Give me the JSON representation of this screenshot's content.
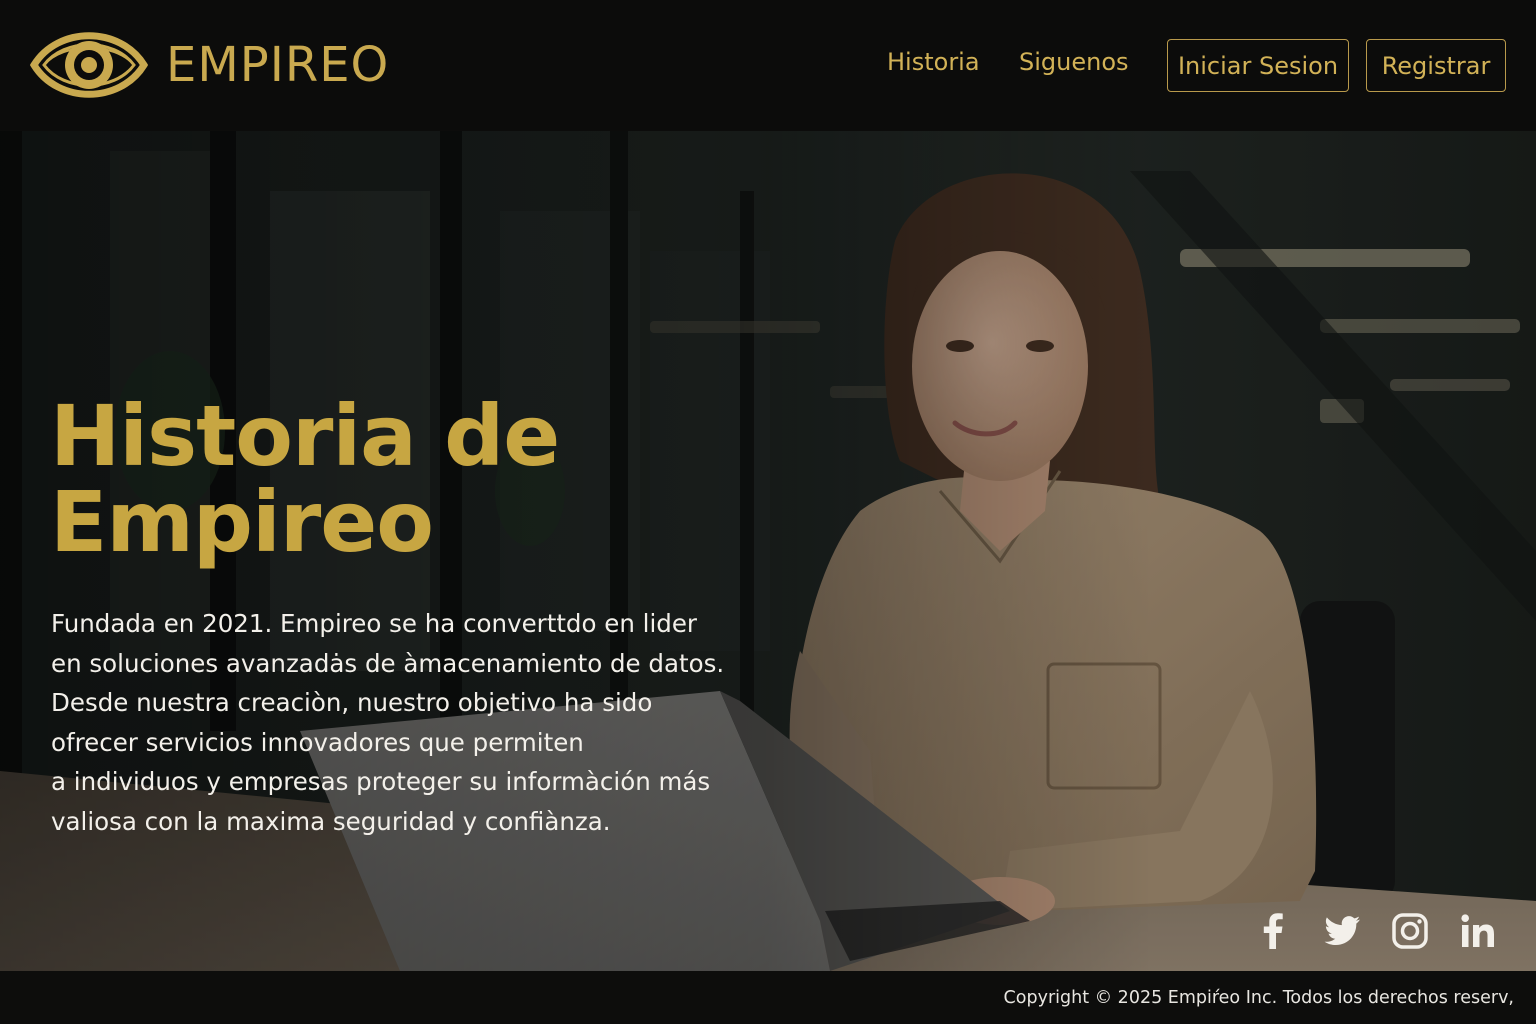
{
  "brand": {
    "name": "EMPIREO",
    "logo_icon": "eye-icon"
  },
  "nav": {
    "links": [
      "Historia",
      "Siguenos"
    ],
    "login_label": "Iniciar Sesion",
    "register_label": "Registrar"
  },
  "hero": {
    "title": "Historia de Empireo",
    "paragraph": "Fundada en 2021. Empireo se ha converttdo en lider en soluciones avanzadȧs de àmacenamiento de datos. Desde nuestra creaciòn, nuestro objetivo ha sido ofrecer servicios innovadores que permiten a individuos y empresas proteger su informàción más valiosa con la maxima seguridad y confiànza.",
    "paragraph_lines": [
      "Fundada en 2021. Empireo se ha converttdo en lider",
      "en soluciones avanzadȧs de àmacenamiento de datos.",
      "Desde nuestra creaciòn, nuestro objetivo ha sido",
      "ofrecer servicios innovadores que permiten",
      "a individuos y empresas proteger su informàción más",
      "valiosa con la maxima seguridad y confiànza."
    ],
    "background_image": "woman working on laptop in office"
  },
  "social": [
    {
      "name": "facebook-icon"
    },
    {
      "name": "twitter-icon"
    },
    {
      "name": "instagram-icon"
    },
    {
      "name": "linkedin-icon"
    }
  ],
  "footer": {
    "copyright": "Copyright © 2025 Empiŕeo Inc. Todos los derechos reserv,"
  },
  "colors": {
    "gold": "#c9a94f",
    "header_bg": "#0c0c0b",
    "text_light": "#f3f0ea"
  }
}
